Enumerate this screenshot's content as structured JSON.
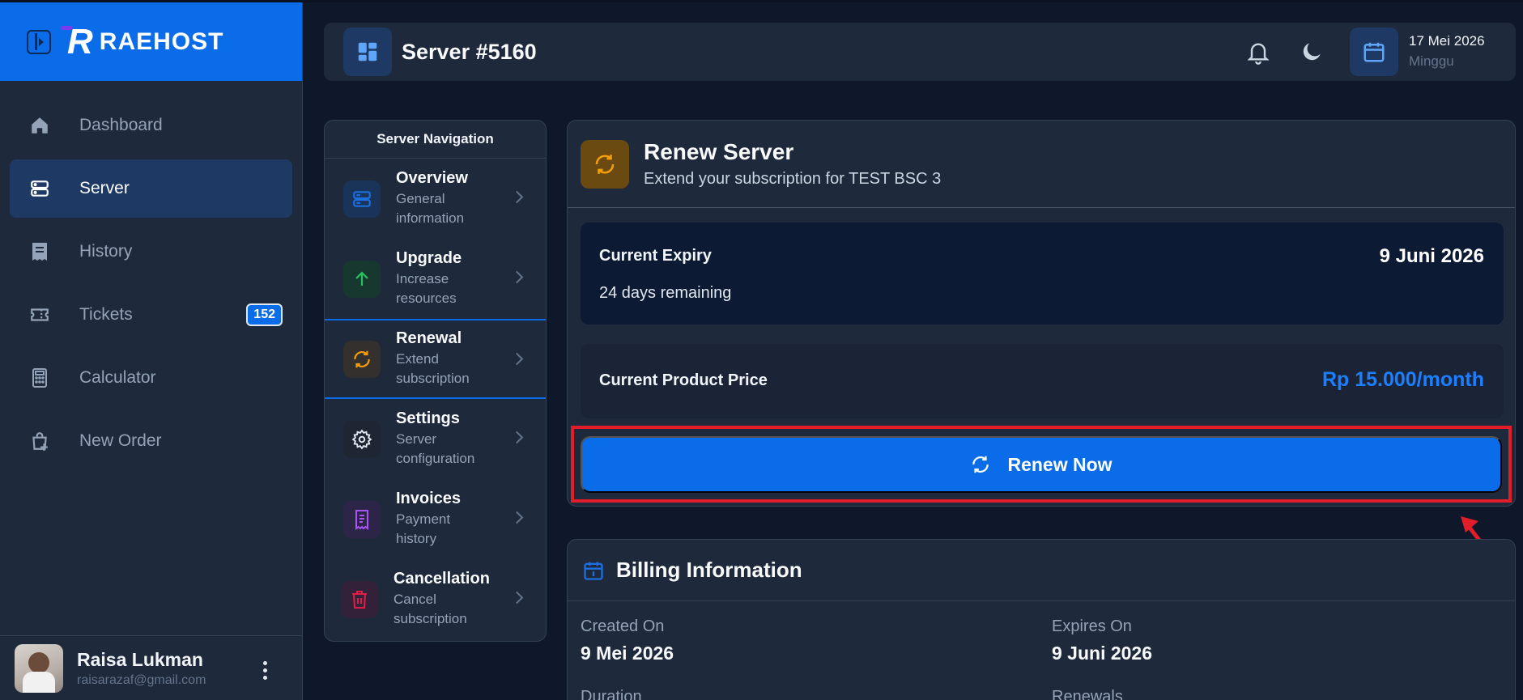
{
  "brand": {
    "name": "RAEHOST",
    "logo_letter": "R"
  },
  "sidebar": {
    "items": [
      {
        "label": "Dashboard",
        "icon": "home-icon",
        "active": false
      },
      {
        "label": "Server",
        "icon": "server-icon",
        "active": true
      },
      {
        "label": "History",
        "icon": "receipt-icon",
        "active": false
      },
      {
        "label": "Tickets",
        "icon": "ticket-icon",
        "active": false,
        "badge": "152"
      },
      {
        "label": "Calculator",
        "icon": "calculator-icon",
        "active": false
      },
      {
        "label": "New Order",
        "icon": "shopping-bag-plus-icon",
        "active": false
      }
    ]
  },
  "user": {
    "name": "Raisa Lukman",
    "email": "raisarazaf@gmail.com"
  },
  "header": {
    "title": "Server #5160",
    "date": "17 Mei 2026",
    "day": "Minggu"
  },
  "server_nav": {
    "title": "Server Navigation",
    "items": [
      {
        "title": "Overview",
        "subtitle": "General information",
        "icon": "server-icon",
        "color": "#1d6fe0"
      },
      {
        "title": "Upgrade",
        "subtitle": "Increase resources",
        "icon": "arrow-up-icon",
        "color": "#22c55e"
      },
      {
        "title": "Renewal",
        "subtitle": "Extend subscription",
        "icon": "refresh-icon",
        "color": "#f59e0b"
      },
      {
        "title": "Settings",
        "subtitle": "Server configuration",
        "icon": "gear-icon",
        "color": "#e2e8f0"
      },
      {
        "title": "Invoices",
        "subtitle": "Payment history",
        "icon": "invoice-icon",
        "color": "#a855f7"
      },
      {
        "title": "Cancellation",
        "subtitle": "Cancel subscription",
        "icon": "trash-icon",
        "color": "#e11d48"
      }
    ]
  },
  "renew": {
    "title": "Renew Server",
    "subtitle": "Extend your subscription for TEST BSC 3",
    "expiry_label": "Current Expiry",
    "expiry_date": "9 Juni 2026",
    "remaining": "24 days remaining",
    "price_label": "Current Product Price",
    "price_value": "Rp 15.000/month",
    "button_label": "Renew Now"
  },
  "billing": {
    "title": "Billing Information",
    "created_label": "Created On",
    "created_value": "9 Mei 2026",
    "expires_label": "Expires On",
    "expires_value": "9 Juni 2026",
    "duration_label": "Duration",
    "renewals_label": "Renewals"
  },
  "colors": {
    "primary": "#0a6ce8",
    "highlight": "#e11d2a",
    "price": "#1c7fff"
  }
}
